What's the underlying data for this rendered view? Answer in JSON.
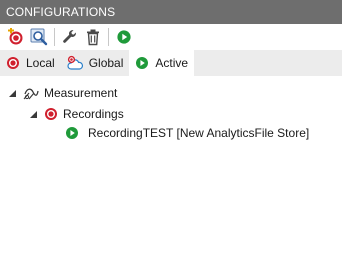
{
  "panel": {
    "title": "CONFIGURATIONS"
  },
  "toolbar": {
    "buttons": [
      {
        "name": "new-configuration",
        "icon": "record-add-icon"
      },
      {
        "name": "search",
        "icon": "magnifier-icon"
      },
      {
        "name": "properties",
        "icon": "wrench-icon"
      },
      {
        "name": "delete",
        "icon": "trash-icon"
      },
      {
        "name": "run",
        "icon": "play-icon"
      }
    ]
  },
  "tabs": [
    {
      "label": "Local",
      "icon": "record-icon",
      "active": false
    },
    {
      "label": "Global",
      "icon": "cloud-record-icon",
      "active": false
    },
    {
      "label": "Active",
      "icon": "play-icon",
      "active": true
    }
  ],
  "tree": {
    "root": {
      "label": "Measurement",
      "icon": "measurement-icon",
      "expanded": true
    },
    "group": {
      "label": "Recordings",
      "icon": "record-icon",
      "expanded": true
    },
    "item": {
      "label": "RecordingTEST [New AnalyticsFile Store]",
      "icon": "play-icon"
    }
  },
  "colors": {
    "titlebar": "#6e6e6e",
    "record_red": "#d0202e",
    "play_green": "#1f9a3a",
    "tab_strip": "#ececec"
  }
}
